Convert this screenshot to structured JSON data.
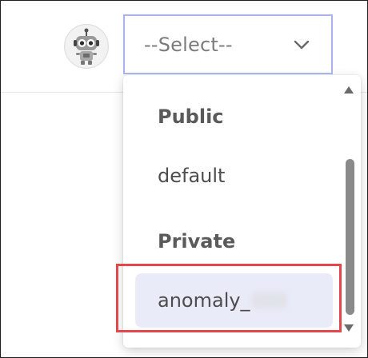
{
  "select": {
    "placeholder": "--Select--",
    "icon": "chevron-down-icon"
  },
  "dropdown": {
    "groups": [
      {
        "label": "Public",
        "options": [
          {
            "label": "default"
          }
        ]
      },
      {
        "label": "Private",
        "options": [
          {
            "label": "anomaly_",
            "redacted_suffix": true,
            "selected": true
          }
        ]
      }
    ]
  },
  "colors": {
    "select_border": "#a9b4ec",
    "highlight_box": "#e3474c",
    "selected_option_bg": "#e9ebf8"
  }
}
